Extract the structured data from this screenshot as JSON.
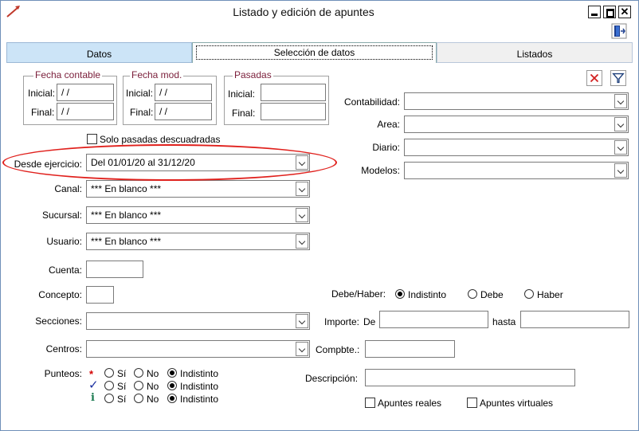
{
  "window": {
    "title": "Listado y edición de apuntes"
  },
  "tabs": [
    {
      "label": "Datos"
    },
    {
      "label": "Selección de datos"
    },
    {
      "label": "Listados"
    }
  ],
  "groups": {
    "fecha_contable": {
      "legend": "Fecha contable",
      "inicial_label": "Inicial:",
      "inicial_value": " / /",
      "final_label": "Final:",
      "final_value": " / /"
    },
    "fecha_mod": {
      "legend": "Fecha mod.",
      "inicial_label": "Inicial:",
      "inicial_value": " / /",
      "final_label": "Final:",
      "final_value": " / /"
    },
    "pasadas": {
      "legend": "Pasadas",
      "inicial_label": "Inicial:",
      "inicial_value": "",
      "final_label": "Final:",
      "final_value": ""
    }
  },
  "solo_pasadas": {
    "label": "Solo pasadas descuadradas",
    "checked": false
  },
  "left_fields": {
    "desde_ejercicio": {
      "label": "Desde ejercicio:",
      "value": "Del 01/01/20 al 31/12/20"
    },
    "canal": {
      "label": "Canal:",
      "value": "*** En blanco ***"
    },
    "sucursal": {
      "label": "Sucursal:",
      "value": "*** En blanco ***"
    },
    "usuario": {
      "label": "Usuario:",
      "value": "*** En blanco ***"
    },
    "cuenta": {
      "label": "Cuenta:",
      "value": ""
    },
    "concepto": {
      "label": "Concepto:",
      "value": ""
    },
    "secciones": {
      "label": "Secciones:",
      "value": ""
    },
    "centros": {
      "label": "Centros:",
      "value": ""
    }
  },
  "punteos": {
    "label": "Punteos:",
    "rows": [
      {
        "marker": "*",
        "marker_color": "#d40000",
        "options": [
          "Sí",
          "No",
          "Indistinto"
        ],
        "selected": 2
      },
      {
        "marker": "✓",
        "marker_color": "#1a2fa0",
        "options": [
          "Sí",
          "No",
          "Indistinto"
        ],
        "selected": 2
      },
      {
        "marker": "i",
        "marker_color": "#1a7a50",
        "options": [
          "Sí",
          "No",
          "Indistinto"
        ],
        "selected": 2
      }
    ]
  },
  "right_fields": {
    "contabilidad": {
      "label": "Contabilidad:",
      "value": ""
    },
    "area": {
      "label": "Area:",
      "value": ""
    },
    "diario": {
      "label": "Diario:",
      "value": ""
    },
    "modelos": {
      "label": "Modelos:",
      "value": ""
    }
  },
  "debe_haber": {
    "label": "Debe/Haber:",
    "options": [
      "Indistinto",
      "Debe",
      "Haber"
    ],
    "selected": 0
  },
  "importe": {
    "label": "Importe:",
    "de_label": "De",
    "de_value": "",
    "hasta_label": "hasta",
    "hasta_value": ""
  },
  "compbte": {
    "label": "Compbte.:",
    "value": ""
  },
  "descripcion": {
    "label": "Descripción:",
    "value": ""
  },
  "apuntes": {
    "reales_label": "Apuntes reales",
    "virtuales_label": "Apuntes virtuales"
  },
  "colors": {
    "annotation": "#e0201c",
    "legend_text": "#7a1e3a",
    "active_tab": "#cce4f7"
  },
  "icons": {
    "app": "app-pen-icon",
    "exit": "exit-door-icon",
    "clear": "clear-x-icon",
    "filter": "filter-icon"
  }
}
